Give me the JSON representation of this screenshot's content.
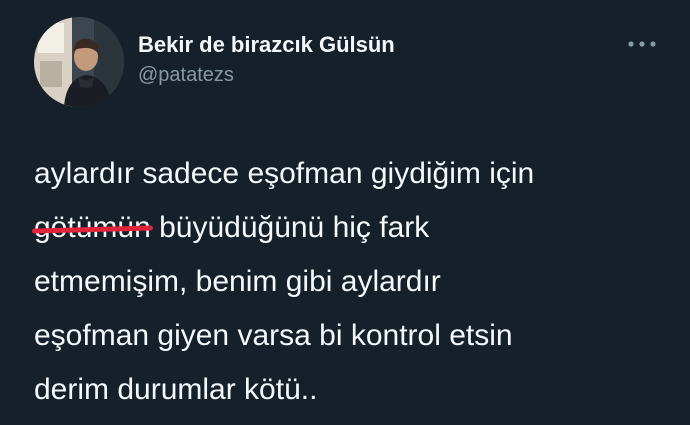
{
  "user": {
    "display_name": "Bekir de birazcık Gülsün",
    "handle": "@patatezs"
  },
  "tweet": {
    "line1": "aylardır sadece eşofman giydiğim için",
    "line2_censored": "götümün",
    "line2_rest": " büyüdüğünü hiç fark",
    "line3": "etmemişim, benim gibi aylardır",
    "line4": "eşofman giyen varsa bi kontrol etsin",
    "line5": "derim durumlar kötü.."
  },
  "icons": {
    "avatar": "profile-photo",
    "more": "more-horizontal-icon"
  },
  "colors": {
    "background": "#15202b",
    "text_primary": "#f5f8fa",
    "text_secondary": "#8899a6",
    "censor_mark": "#e0243a"
  }
}
